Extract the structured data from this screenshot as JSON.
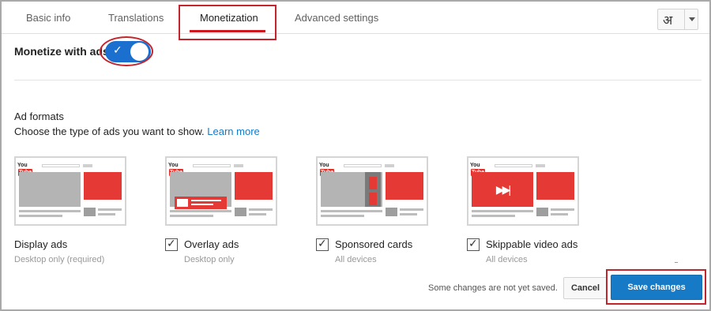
{
  "tabs": [
    {
      "label": "Basic info",
      "active": false
    },
    {
      "label": "Translations",
      "active": false
    },
    {
      "label": "Monetization",
      "active": true
    },
    {
      "label": "Advanced settings",
      "active": false
    }
  ],
  "language_button": {
    "glyph": "अ",
    "icon": "chevron-down-icon"
  },
  "monetize": {
    "label": "Monetize with ads",
    "enabled": true
  },
  "ad_formats": {
    "title": "Ad formats",
    "description": "Choose the type of ads you want to show.",
    "learn_more": "Learn more",
    "options": [
      {
        "label": "Display ads",
        "sub": "Desktop only (required)",
        "checked": true,
        "has_checkbox": false
      },
      {
        "label": "Overlay ads",
        "sub": "Desktop only",
        "checked": true,
        "has_checkbox": true
      },
      {
        "label": "Sponsored cards",
        "sub": "All devices",
        "checked": true,
        "has_checkbox": true
      },
      {
        "label": "Skippable video ads",
        "sub": "All devices",
        "checked": true,
        "has_checkbox": true
      }
    ],
    "preview_logo": {
      "prefix": "You",
      "suffix": "Tube"
    }
  },
  "footer": {
    "status": "Some changes are not yet saved.",
    "cancel_label": "Cancel",
    "save_label": "Save changes"
  },
  "colors": {
    "accent_blue": "#167ac6",
    "toggle_blue": "#1a6fcf",
    "highlight_red": "#c4242b",
    "ad_red": "#e53935"
  }
}
